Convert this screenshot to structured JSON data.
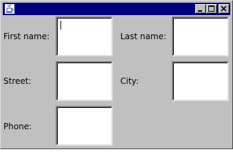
{
  "window": {
    "title": "",
    "icon": "java-coffee-cup-icon",
    "buttons": {
      "minimize": "minimize-icon",
      "maximize": "maximize-icon",
      "close": "close-icon"
    },
    "colors": {
      "titlebar": "#000080",
      "background": "#c0c0c0"
    }
  },
  "form": {
    "first_name": {
      "label": "First name:",
      "value": ""
    },
    "last_name": {
      "label": "Last name:",
      "value": ""
    },
    "street": {
      "label": "Street:",
      "value": ""
    },
    "city": {
      "label": "City:",
      "value": ""
    },
    "phone": {
      "label": "Phone:",
      "value": ""
    }
  }
}
